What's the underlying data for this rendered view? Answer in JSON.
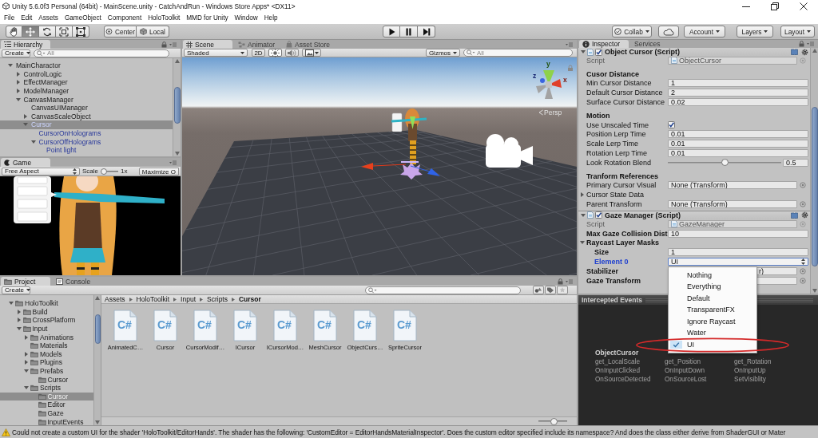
{
  "window": {
    "title": "Unity 5.6.0f3 Personal (64bit) - MainScene.unity - CatchAndRun - Windows Store Apps* <DX11>",
    "controls": [
      {
        "kind": "minimize"
      },
      {
        "kind": "restore"
      },
      {
        "kind": "close"
      }
    ]
  },
  "menu_bar": [
    "File",
    "Edit",
    "Assets",
    "GameObject",
    "Component",
    "HoloToolkit",
    "MMD for Unity",
    "Window",
    "Help"
  ],
  "toolbar": {
    "tools": [
      {
        "kind": "hand",
        "selected": false
      },
      {
        "kind": "move",
        "selected": true
      },
      {
        "kind": "rotate",
        "selected": false
      },
      {
        "kind": "scale",
        "selected": false
      },
      {
        "kind": "rect",
        "selected": false
      }
    ],
    "pivot": [
      {
        "kind": "center",
        "label": "Center"
      },
      {
        "kind": "local",
        "label": "Local"
      }
    ],
    "playback": [
      {
        "kind": "play",
        "selected": false
      },
      {
        "kind": "pause",
        "selected": false
      },
      {
        "kind": "step",
        "selected": false
      }
    ],
    "services": [
      {
        "kind": "collab",
        "label": "Collab"
      },
      {
        "kind": "cloud"
      },
      {
        "kind": "account",
        "label": "Account"
      },
      {
        "kind": "layers",
        "label": "Layers"
      },
      {
        "kind": "layout",
        "label": "Layout"
      }
    ]
  },
  "hierarchy": {
    "tab": "Hierarchy",
    "create": "Create",
    "search_placeholder": "All",
    "items": [
      {
        "label": "MainCharactor",
        "expanded": true,
        "selected": false,
        "prefab": false,
        "children": [
          {
            "label": "ControlLogic",
            "expanded": false,
            "selected": false,
            "prefab": false
          },
          {
            "label": "EffectManager",
            "expanded": false,
            "selected": false,
            "prefab": false
          },
          {
            "label": "ModelManager",
            "expanded": false,
            "selected": false,
            "prefab": false
          },
          {
            "label": "CanvasManager",
            "expanded": true,
            "selected": false,
            "prefab": false,
            "children": [
              {
                "label": "CanvasUIManager",
                "selected": false,
                "prefab": false
              },
              {
                "label": "CanvasScaleObject",
                "expanded": false,
                "selected": false,
                "prefab": false
              },
              {
                "label": "Cursor",
                "expanded": true,
                "selected": true,
                "prefab": true,
                "children": [
                  {
                    "label": "CursorOnHolograms",
                    "selected": false,
                    "prefab": true
                  },
                  {
                    "label": "CursorOffHolograms",
                    "expanded": true,
                    "selected": false,
                    "prefab": true,
                    "children": [
                      {
                        "label": "Point light",
                        "selected": false,
                        "prefab": true
                      }
                    ]
                  }
                ]
              }
            ]
          }
        ]
      }
    ]
  },
  "game": {
    "tab": "Game",
    "aspect": "Free Aspect",
    "scale_label": "Scale",
    "scale": {
      "level": 0
    },
    "scale_value": "1x",
    "maximize": "Maximize O"
  },
  "scene": {
    "tabs": [
      {
        "kind": "scene",
        "label": "Scene",
        "selected": true
      },
      {
        "kind": "animator",
        "label": "Animator",
        "selected": false
      },
      {
        "kind": "store",
        "label": "Asset Store",
        "selected": false
      }
    ],
    "shading": "Shaded",
    "mode_2d": {
      "label": "2D",
      "on": false
    },
    "toggles": [
      {
        "kind": "lighting",
        "on": true
      },
      {
        "kind": "audio",
        "on": false
      },
      {
        "kind": "effects",
        "on": false
      }
    ],
    "gizmos": "Gizmos",
    "search_placeholder": "All",
    "axes": [
      "y",
      "z",
      "x"
    ],
    "projection": "Persp"
  },
  "inspector": {
    "tabs": [
      {
        "kind": "inspector",
        "label": "Inspector",
        "selected": true
      },
      {
        "kind": "services",
        "label": "Services",
        "selected": false
      }
    ],
    "components": [
      {
        "title": "Object Cursor (Script)",
        "expanded": true,
        "enabled": true,
        "rows": [
          {
            "kind": "script",
            "label": "Script",
            "value": "ObjectCursor"
          },
          {
            "kind": "header",
            "label": "Cusor Distance"
          },
          {
            "kind": "field",
            "label": "Min Cursor Distance",
            "value": "1",
            "modified": false,
            "focused": false
          },
          {
            "kind": "field",
            "label": "Default Cursor Distance",
            "value": "2",
            "modified": false,
            "focused": false
          },
          {
            "kind": "field",
            "label": "Surface Cursor Distance",
            "value": "0.02",
            "modified": false,
            "focused": false
          },
          {
            "kind": "header",
            "label": "Motion"
          },
          {
            "kind": "checkbox",
            "label": "Use Unscaled Time",
            "checked": true,
            "modified": false,
            "focused": false
          },
          {
            "kind": "field",
            "label": "Position Lerp Time",
            "value": "0.01",
            "modified": false,
            "focused": false
          },
          {
            "kind": "field",
            "label": "Scale Lerp Time",
            "value": "0.01",
            "modified": false,
            "focused": false
          },
          {
            "kind": "field",
            "label": "Rotation Lerp Time",
            "value": "0.01",
            "modified": false,
            "focused": false
          },
          {
            "kind": "slider",
            "label": "Look Rotation Blend",
            "level": 0.5,
            "value": "0.5",
            "modified": false,
            "focused": false
          },
          {
            "kind": "header",
            "label": "Tranform References"
          },
          {
            "kind": "object",
            "label": "Primary Cursor Visual",
            "value": "None (Transform)",
            "modified": false,
            "focused": false
          },
          {
            "kind": "foldout",
            "label": "Cursor State Data",
            "expanded": false,
            "modified": false,
            "focused": false
          },
          {
            "kind": "object",
            "label": "Parent Transform",
            "value": "None (Transform)",
            "modified": false,
            "focused": false
          }
        ]
      },
      {
        "title": "Gaze Manager (Script)",
        "expanded": true,
        "enabled": true,
        "rows": [
          {
            "kind": "script",
            "label": "Script",
            "value": "GazeManager"
          },
          {
            "kind": "field",
            "label": "Max Gaze Collision Dist",
            "value": "10",
            "modified": true,
            "focused": false
          },
          {
            "kind": "foldout",
            "label": "Raycast Layer Masks",
            "expanded": true,
            "modified": true,
            "focused": false,
            "children": [
              {
                "kind": "field",
                "label": "Size",
                "value": "1",
                "modified": true,
                "focused": false
              },
              {
                "kind": "dropdown",
                "label": "Element 0",
                "value": "UI",
                "modified": true,
                "focused": true,
                "popup": {
                  "options": [
                    {
                      "label": "Nothing",
                      "selected": false,
                      "circled": false
                    },
                    {
                      "label": "Everything",
                      "selected": false,
                      "circled": false
                    },
                    {
                      "label": "Default",
                      "selected": false,
                      "circled": false
                    },
                    {
                      "label": "TransparentFX",
                      "selected": false,
                      "circled": false
                    },
                    {
                      "label": "Ignore Raycast",
                      "selected": false,
                      "circled": false
                    },
                    {
                      "label": "Water",
                      "selected": false,
                      "circled": false
                    },
                    {
                      "label": "UI",
                      "selected": true,
                      "circled": true
                    }
                  ]
                }
              }
            ]
          },
          {
            "kind": "object",
            "label": "Stabilizer",
            "value": "r)",
            "modified": true,
            "focused": false
          },
          {
            "kind": "object",
            "label": "Gaze Transform",
            "modified": true,
            "focused": false
          }
        ]
      }
    ]
  },
  "intercepted_events": {
    "title": "Intercepted Events",
    "object": "ObjectCursor",
    "events": [
      "get_LocalScale",
      "get_Position",
      "get_Rotation",
      "OnInputClicked",
      "OnInputDown",
      "OnInputUp",
      "OnSourceDetected",
      "OnSourceLost",
      "SetVisiblity"
    ]
  },
  "project": {
    "tabs": [
      {
        "kind": "project",
        "label": "Project",
        "selected": true
      },
      {
        "kind": "console",
        "label": "Console",
        "selected": false
      }
    ],
    "create": "Create",
    "tree": [
      {
        "label": "HoloToolkit",
        "expanded": true,
        "selected": false,
        "children": [
          {
            "label": "Build",
            "expanded": false,
            "selected": false
          },
          {
            "label": "CrossPlatform",
            "expanded": false,
            "selected": false
          },
          {
            "label": "Input",
            "expanded": true,
            "selected": false,
            "children": [
              {
                "label": "Animations",
                "expanded": false,
                "selected": false
              },
              {
                "label": "Materials",
                "selected": false
              },
              {
                "label": "Models",
                "expanded": false,
                "selected": false
              },
              {
                "label": "Plugins",
                "expanded": false,
                "selected": false
              },
              {
                "label": "Prefabs",
                "expanded": true,
                "selected": false,
                "children": [
                  {
                    "label": "Cursor",
                    "selected": false
                  }
                ]
              },
              {
                "label": "Scripts",
                "expanded": true,
                "selected": false,
                "children": [
                  {
                    "label": "Cursor",
                    "selected": true
                  },
                  {
                    "label": "Editor",
                    "selected": false
                  },
                  {
                    "label": "Gaze",
                    "selected": false
                  },
                  {
                    "label": "InputEvents",
                    "selected": false
                  }
                ]
              }
            ]
          }
        ]
      }
    ],
    "breadcrumb": [
      "Assets",
      "HoloToolkit",
      "Input",
      "Scripts",
      "Cursor"
    ],
    "assets": [
      {
        "name": "AnimatedC…",
        "type": "C#"
      },
      {
        "name": "Cursor",
        "type": "C#"
      },
      {
        "name": "CursorModif…",
        "type": "C#"
      },
      {
        "name": "ICursor",
        "type": "C#"
      },
      {
        "name": "ICursorMod…",
        "type": "C#"
      },
      {
        "name": "MeshCursor",
        "type": "C#"
      },
      {
        "name": "ObjectCurs…",
        "type": "C#"
      },
      {
        "name": "SpriteCursor",
        "type": "C#"
      }
    ],
    "zoom": {
      "level": 0.55
    }
  },
  "status_bar": {
    "kind": "warning",
    "message": "Could not create a custom UI for the shader 'HoloToolkit/EditorHands'. The shader has the following: 'CustomEditor = EditorHandsMaterialInspector'. Does the custom editor specified include its namespace? And does the class either derive from ShaderGUI or Mater"
  }
}
